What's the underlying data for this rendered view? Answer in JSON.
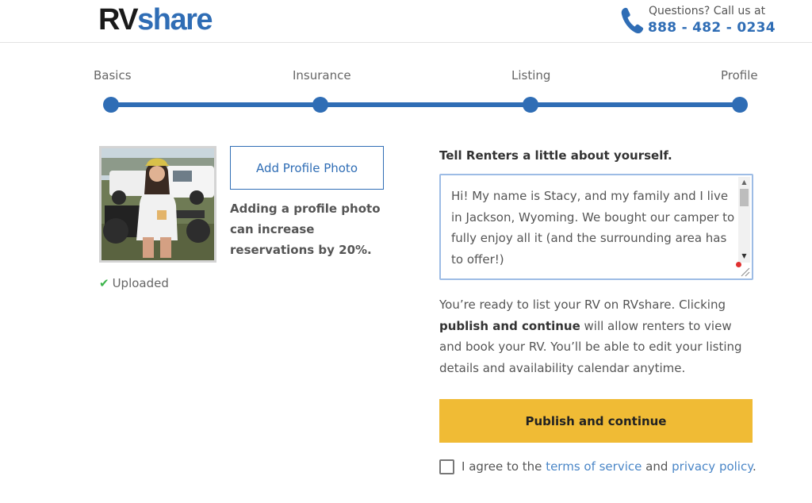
{
  "header": {
    "logo_rv": "RV",
    "logo_share": "share",
    "contact_prompt": "Questions? Call us at",
    "phone": "888 - 482 - 0234"
  },
  "steps": [
    {
      "label": "Basics"
    },
    {
      "label": "Insurance"
    },
    {
      "label": "Listing"
    },
    {
      "label": "Profile"
    }
  ],
  "profile": {
    "add_photo_label": "Add Profile Photo",
    "photo_hint": "Adding a profile photo can increase reservations by 20%.",
    "upload_status": "Uploaded"
  },
  "about": {
    "title": "Tell Renters a little about yourself.",
    "value": "Hi! My name is Stacy, and my family and I live in Jackson, Wyoming. We bought our camper to fully enjoy all it (and the surrounding area has to offer!)"
  },
  "ready": {
    "intro": "You’re ready to list your RV on RVshare. Clicking ",
    "bold": "publish and continue",
    "rest": " will allow renters to view and book your RV. You’ll be able to edit your listing details and availability calendar anytime."
  },
  "publish_label": "Publish and continue",
  "agree": {
    "prefix": "I agree to the ",
    "terms": "terms of service",
    "middle": " and ",
    "privacy": "privacy policy",
    "suffix": "."
  },
  "colors": {
    "brand_blue": "#2f6db5",
    "publish_yellow": "#f0bb35",
    "success_green": "#3cb44b"
  }
}
